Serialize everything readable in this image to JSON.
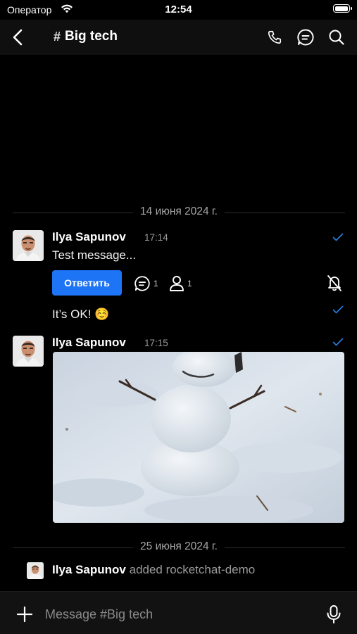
{
  "status_bar": {
    "carrier": "Оператор",
    "time": "12:54"
  },
  "header": {
    "channel_prefix": "#",
    "title": "Big tech"
  },
  "dividers": [
    "14 июня 2024 г.",
    "25 июня 2024 г."
  ],
  "messages": [
    {
      "author": "Ilya Sapunov",
      "time": "17:14",
      "text": "Test message...",
      "reply_label": "Ответить",
      "thread_count": "1",
      "followers_count": "1",
      "followup_text": "It’s OK! ☺️"
    },
    {
      "author": "Ilya Sapunov",
      "time": "17:15",
      "attachment": "image"
    }
  ],
  "system_message": {
    "author": "Ilya Sapunov",
    "text": "added rocketchat-demo"
  },
  "composer": {
    "placeholder": "Message #Big tech"
  },
  "colors": {
    "background": "#000000",
    "accent": "#1d74f5",
    "read_check": "#2a7de1",
    "muted_text": "#9a9a9a"
  }
}
